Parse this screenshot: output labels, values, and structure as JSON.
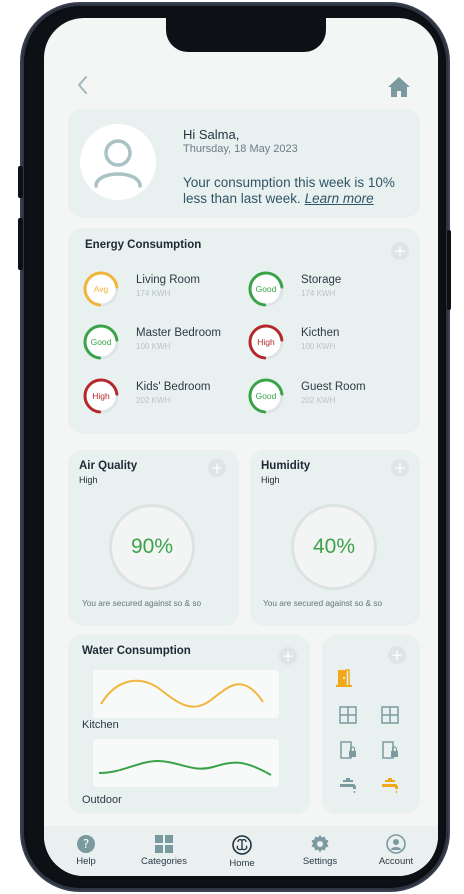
{
  "greeting": {
    "name": "Hi Salma,",
    "date": "Thursday, 18 May 2023",
    "message": "Your consumption this week is 10% less than last week.",
    "link": "Learn more"
  },
  "energy": {
    "title": "Energy Consumption",
    "plus": "+",
    "rooms": [
      {
        "name": "Living Room",
        "kwh": "174 KWH",
        "status": "Avg",
        "color": "#f2b53b"
      },
      {
        "name": "Storage",
        "kwh": "174 KWH",
        "status": "Good",
        "color": "#3aa349"
      },
      {
        "name": "Master Bedroom",
        "kwh": "100 KWH",
        "status": "Good",
        "color": "#3aa349"
      },
      {
        "name": "Kicthen",
        "kwh": "100 KWH",
        "status": "High",
        "color": "#b5292d"
      },
      {
        "name": "Kids' Bedroom",
        "kwh": "202 KWH",
        "status": "High",
        "color": "#b5292d"
      },
      {
        "name": "Guest Room",
        "kwh": "202 KWH",
        "status": "Good",
        "color": "#3aa349"
      }
    ]
  },
  "air_quality": {
    "title": "Air Quality",
    "level": "High",
    "value": "90%",
    "note": "You are secured against so & so",
    "plus": "+"
  },
  "humidity": {
    "title": "Humidity",
    "level": "High",
    "value": "40%",
    "note": "You are secured against so & so",
    "plus": "+"
  },
  "water": {
    "title": "Water Consumption",
    "plus": "+",
    "kitchen_label": "Kitchen",
    "outdoor_label": "Outdoor",
    "kitchen_color": "#f2b53b",
    "outdoor_color": "#3aa349"
  },
  "devices": {
    "plus": "+",
    "icons": [
      "door-icon",
      "window-icon",
      "window-icon",
      "door-lock-icon",
      "door-lock-icon",
      "faucet-icon",
      "faucet-icon"
    ],
    "active_color": "#f2a81b",
    "inactive_color": "#7b9aa0"
  },
  "nav": {
    "items": [
      {
        "label": "Help",
        "icon": "help-icon"
      },
      {
        "label": "Categories",
        "icon": "categories-icon"
      },
      {
        "label": "Home",
        "icon": "home-brain-icon"
      },
      {
        "label": "Settings",
        "icon": "gear-icon"
      },
      {
        "label": "Account",
        "icon": "account-icon"
      }
    ]
  },
  "colors": {
    "accent_good": "#3aa349",
    "accent_avg": "#f2b53b",
    "accent_high": "#b5292d",
    "card_bg": "#e9f0f0",
    "icon_teal": "#7b9aa0"
  }
}
